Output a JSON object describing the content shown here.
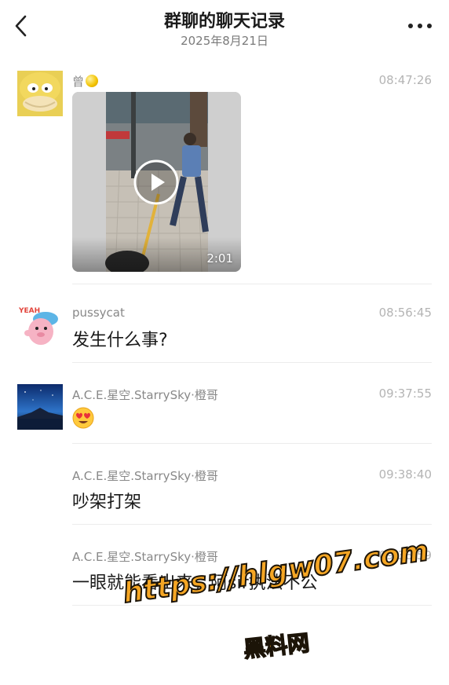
{
  "header": {
    "title": "群聊的聊天记录",
    "date": "2025年8月21日"
  },
  "messages": [
    {
      "sender": "曾",
      "time": "08:47:26",
      "video_duration": "2:01"
    },
    {
      "sender": "pussycat",
      "time": "08:56:45",
      "text": "发生什么事?"
    },
    {
      "sender": "A.C.E.星空.StarrySky·橙哥",
      "time": "09:37:55",
      "emoji": "😍"
    },
    {
      "sender": "A.C.E.星空.StarrySky·橙哥",
      "time": "09:38:40",
      "text": "吵架打架"
    },
    {
      "sender": "A.C.E.星空.StarrySky·橙哥",
      "time": "09:38:59",
      "text": "一眼就能看出来，阿sir执法不公"
    }
  ],
  "watermark": {
    "line1": "https://hlgw07.com",
    "line2": "黑料网"
  }
}
